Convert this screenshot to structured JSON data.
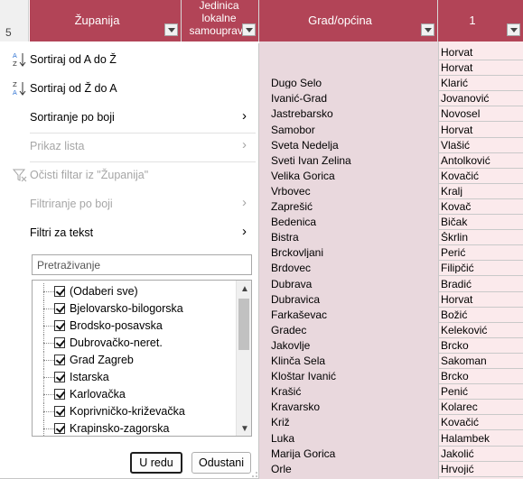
{
  "row_header": "5",
  "columns": [
    {
      "label": "Županija"
    },
    {
      "label": "Jedinica lokalne samouprave"
    },
    {
      "label": "Grad/općina"
    },
    {
      "label": "1"
    }
  ],
  "cities": [
    "",
    "",
    "Dugo Selo",
    "Ivanić-Grad",
    "Jastrebarsko",
    "Samobor",
    "Sveta Nedelja",
    "Sveti Ivan Zelina",
    "Velika Gorica",
    "Vrbovec",
    "Zaprešić",
    "Bedenica",
    "Bistra",
    "Brckovljani",
    "Brdovec",
    "Dubrava",
    "Dubravica",
    "Farkaševac",
    "Gradec",
    "Jakovlje",
    "Klinča Sela",
    "Kloštar Ivanić",
    "Krašić",
    "Kravarsko",
    "Križ",
    "Luka",
    "Marija Gorica",
    "Orle"
  ],
  "surnames": [
    "Horvat",
    "Horvat",
    "Klarić",
    "Jovanović",
    "Novosel",
    "Horvat",
    "Vlašić",
    "Antolković",
    "Kovačić",
    "Kralj",
    "Kovač",
    "Bičak",
    "Škrlin",
    "Perić",
    "Filipčić",
    "Bradić",
    "Horvat",
    "Božić",
    "Kelеković",
    "Brcko",
    "Sakoman",
    "Brcko",
    "Penić",
    "Kolarec",
    "Kovačić",
    "Halambek",
    "Jakolić",
    "Hrvojić"
  ],
  "menu": {
    "sort_az": "Sortiraj od A do Ž",
    "sort_za": "Sortiraj od Ž do A",
    "sort_color": "Sortiranje po boji",
    "sheet_view": "Prikaz lista",
    "clear_filter": "Očisti filtar iz \"Županija\"",
    "filter_color": "Filtriranje po boji",
    "text_filters": "Filtri za tekst",
    "search_placeholder": "Pretraživanje",
    "list_items": [
      "(Odaberi sve)",
      "Bjelovarsko-bilogorska",
      "Brodsko-posavska",
      "Dubrovačko-neret.",
      "Grad Zagreb",
      "Istarska",
      "Karlovačka",
      "Koprivničko-križevačka",
      "Krapinsko-zagorska"
    ],
    "ok": "U redu",
    "cancel": "Odustani"
  },
  "colors": {
    "header_bg": "#b24457",
    "column_c_bg": "#e9d8dd",
    "column_d_bg": "#fbeaec"
  }
}
